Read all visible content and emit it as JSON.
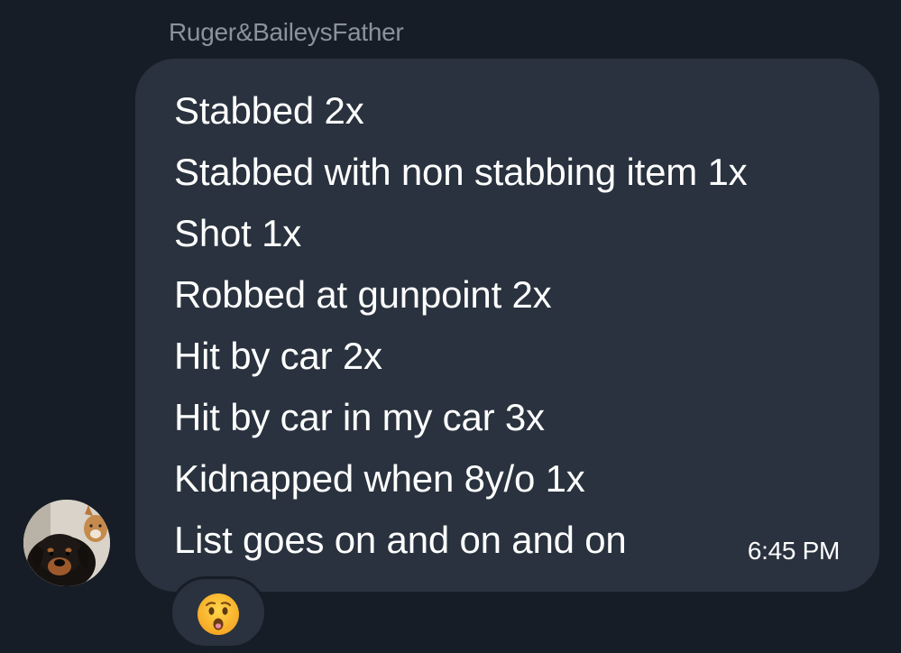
{
  "message": {
    "sender": "Ruger&BaileysFather",
    "lines": [
      "Stabbed 2x",
      "Stabbed with non stabbing item 1x",
      "Shot 1x",
      "Robbed at gunpoint 2x",
      "Hit by car 2x",
      "Hit by car in my car 3x",
      "Kidnapped when 8y/o 1x",
      "List goes on and on and on"
    ],
    "time": "6:45 PM",
    "reaction": "hushed-face-emoji"
  },
  "colors": {
    "background": "#171d26",
    "bubble": "#29323e",
    "text": "#ffffff",
    "sender": "#8a929c"
  }
}
